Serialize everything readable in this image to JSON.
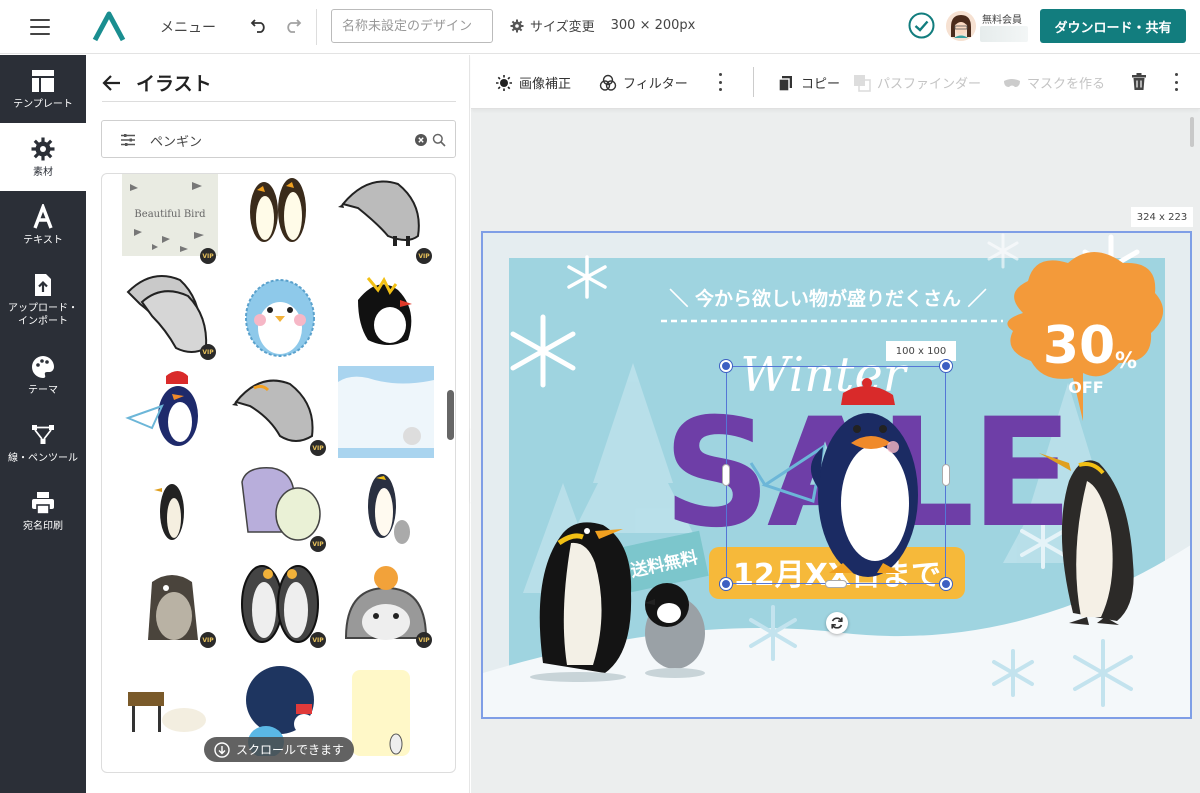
{
  "topbar": {
    "menu_label": "メニュー",
    "title_placeholder": "名称未設定のデザイン",
    "resize_label": "サイズ変更",
    "size_text": "300 × 200px",
    "member_label": "無料会員",
    "download_label": "ダウンロード・共有"
  },
  "sidebar": {
    "items": [
      {
        "label": "テンプレート",
        "icon": "template-icon"
      },
      {
        "label": "素材",
        "icon": "gear-icon"
      },
      {
        "label": "テキスト",
        "icon": "text-icon"
      },
      {
        "label": "アップロード・インポート",
        "icon": "upload-icon"
      },
      {
        "label": "テーマ",
        "icon": "palette-icon"
      },
      {
        "label": "線・ペンツール",
        "icon": "pen-tool-icon"
      },
      {
        "label": "宛名印刷",
        "icon": "printer-icon"
      }
    ]
  },
  "panel": {
    "title": "イラスト",
    "search_value": "ペンギン",
    "vip_label": "VIP",
    "thumb_text": "Beautiful Bird",
    "scroll_hint": "スクロールできます"
  },
  "toolbar": {
    "image_fix": "画像補正",
    "filter": "フィルター",
    "copy": "コピー",
    "pathfinder": "パスファインダー",
    "mask": "マスクを作る"
  },
  "canvas": {
    "design_size": "324 x 223",
    "selection_size": "100 x 100",
    "headline": "＼ 今から欲しい物が盛りだくさん ／",
    "winter": "Winter",
    "sale": "SALE",
    "discount": "30",
    "discount_unit": "%",
    "discount_off": "OFF",
    "free_shipping": "送料無料",
    "date_text": "12月XX日まで"
  },
  "colors": {
    "brand": "#127d7e",
    "sale_purple": "#6e3ea7",
    "orange": "#f39a3a",
    "sidebar_bg": "#2b2f37",
    "selection": "#3d5fc2"
  }
}
